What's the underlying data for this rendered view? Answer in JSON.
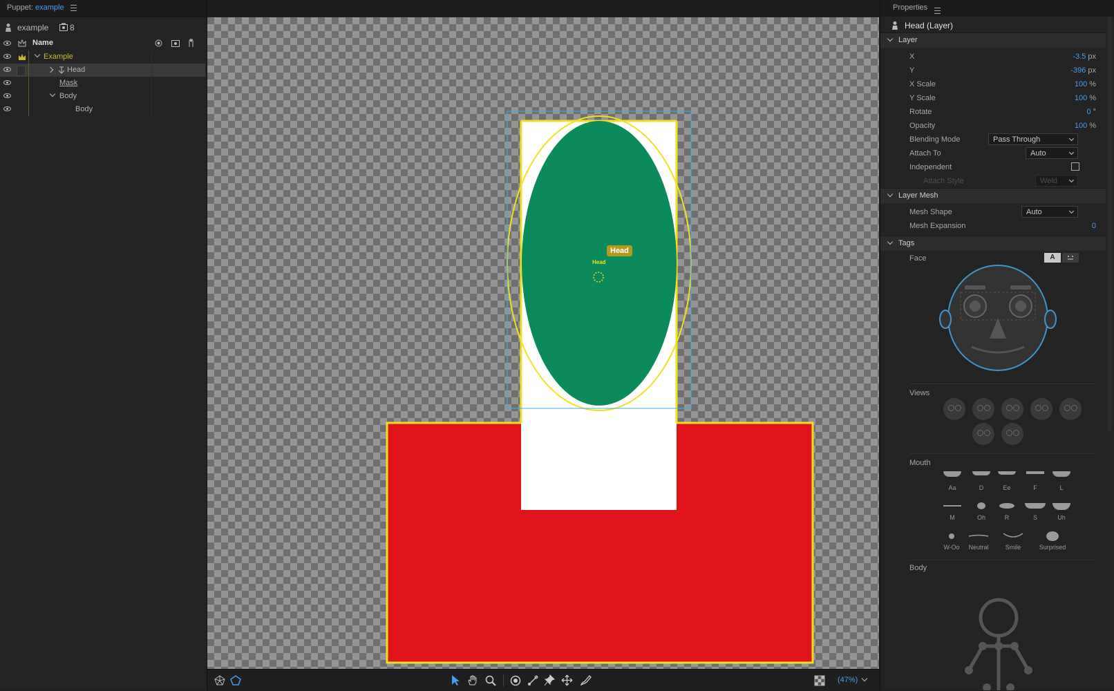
{
  "puppet_panel": {
    "title_prefix": "Puppet:",
    "title_name": "example",
    "puppet_name": "example",
    "count": "8",
    "column_name": "Name",
    "layers": [
      {
        "label": "Example"
      },
      {
        "label": "Head"
      },
      {
        "label": "Mask"
      },
      {
        "label": "Body"
      },
      {
        "label": "Body"
      }
    ]
  },
  "canvas": {
    "handle_label": "Head",
    "handle_small_label": "Head",
    "colors": {
      "head": "#0b8a5b",
      "body": "#e0151b",
      "neck": "#ffffff",
      "outline": "#f0e020"
    }
  },
  "bottom_bar": {
    "zoom": "(47%)"
  },
  "properties": {
    "title": "Properties",
    "selection": "Head (Layer)",
    "layer_section": "Layer",
    "fields": [
      {
        "label": "X",
        "value": "-3.5",
        "unit": "px"
      },
      {
        "label": "Y",
        "value": "-396",
        "unit": "px"
      },
      {
        "label": "X Scale",
        "value": "100",
        "unit": "%"
      },
      {
        "label": "Y Scale",
        "value": "100",
        "unit": "%"
      },
      {
        "label": "Rotate",
        "value": "0",
        "unit": "°"
      },
      {
        "label": "Opacity",
        "value": "100",
        "unit": "%"
      }
    ],
    "blending_mode_label": "Blending Mode",
    "blending_mode_value": "Pass Through",
    "attach_to_label": "Attach To",
    "attach_to_value": "Auto",
    "independent_label": "Independent",
    "attach_style_label": "Attach Style",
    "attach_style_value": "Weld",
    "mesh_section": "Layer Mesh",
    "mesh_shape_label": "Mesh Shape",
    "mesh_shape_value": "Auto",
    "mesh_expansion_label": "Mesh Expansion",
    "mesh_expansion_value": "0",
    "tags_section": "Tags",
    "face_label": "Face",
    "face_toggle_a": "A",
    "views_label": "Views",
    "mouth_label": "Mouth",
    "mouth_items": [
      "Aa",
      "D",
      "Ee",
      "F",
      "L",
      "M",
      "Oh",
      "R",
      "S",
      "Uh",
      "W-Oo",
      "Neutral",
      "Smile",
      "Surprised"
    ],
    "body_label": "Body"
  }
}
